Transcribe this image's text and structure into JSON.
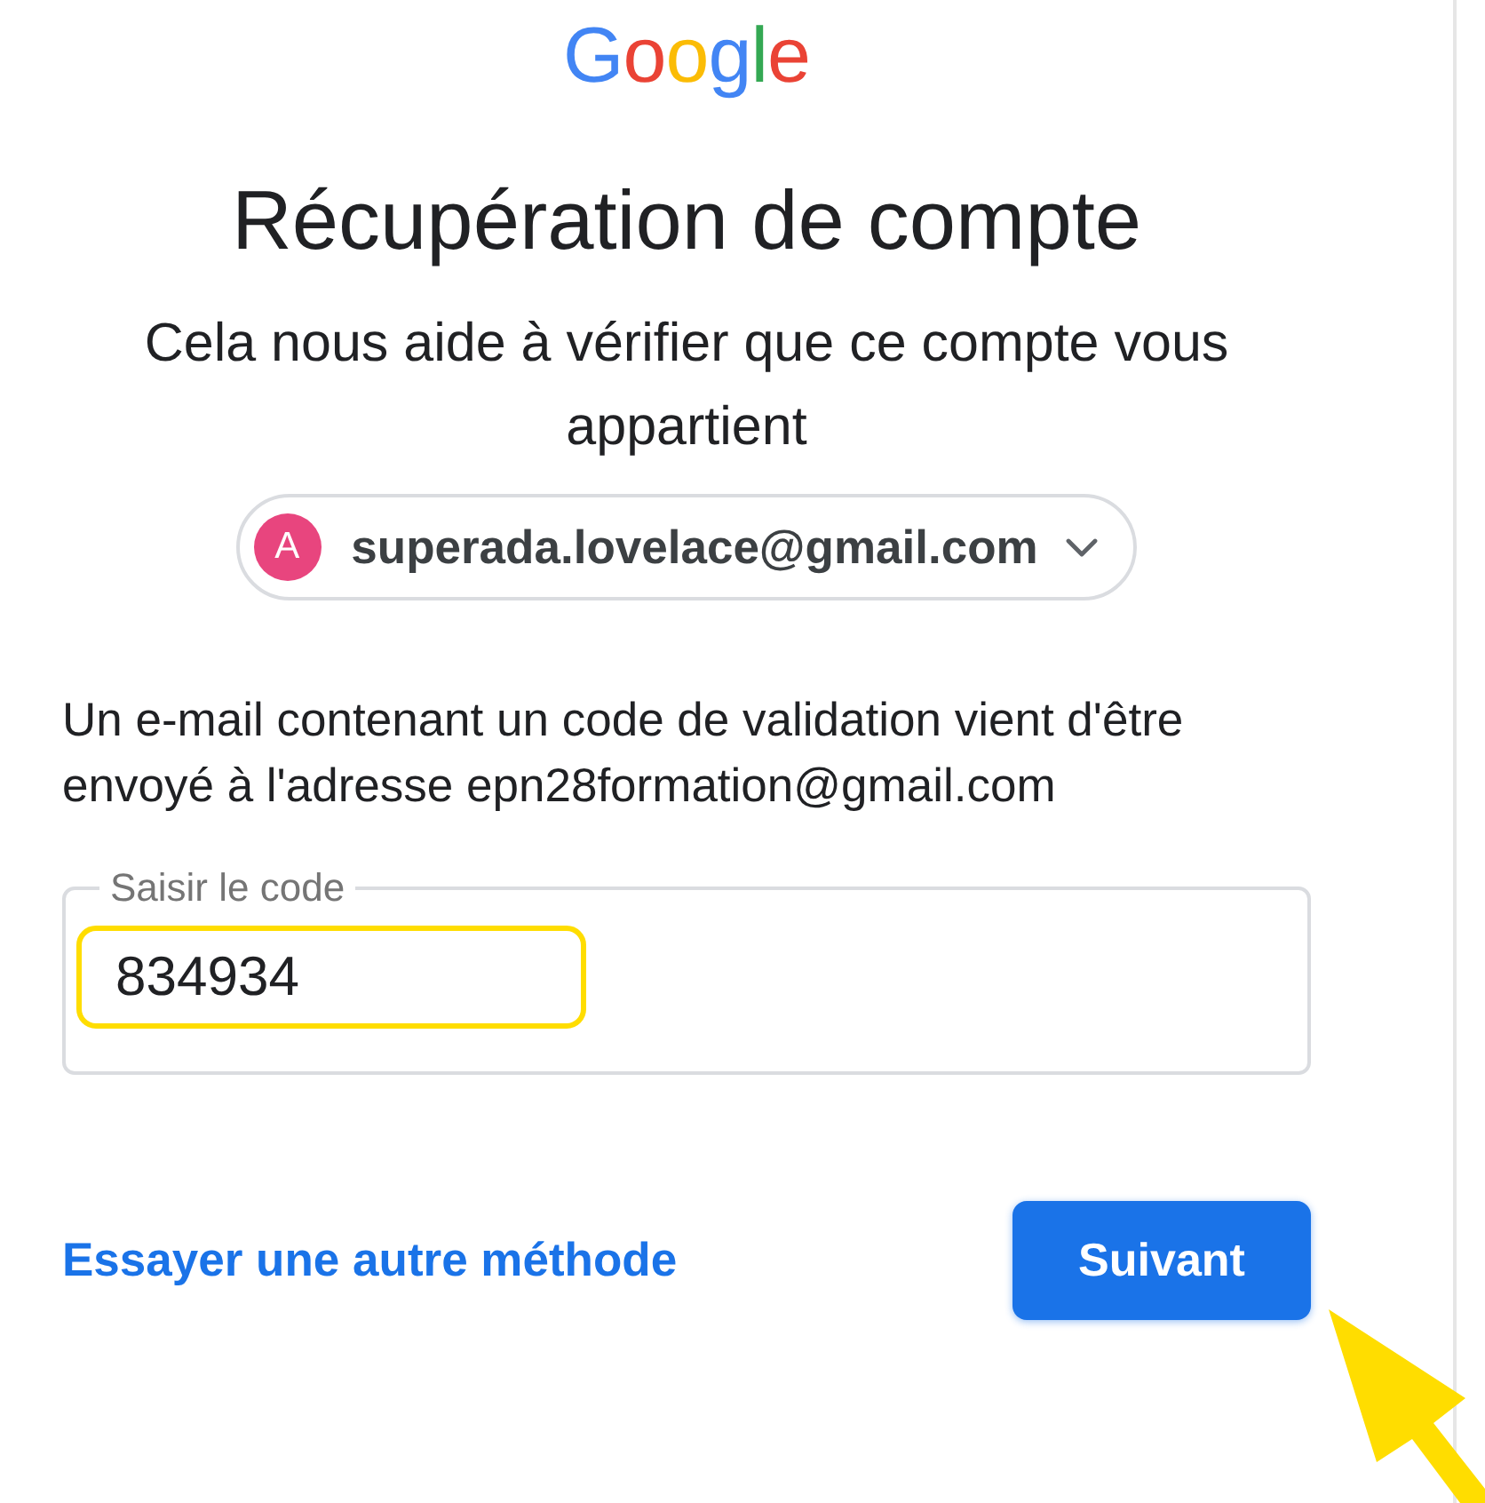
{
  "logo": {
    "text": "Google"
  },
  "heading": {
    "title": "Récupération de compte",
    "subtitle": "Cela nous aide à vérifier que ce compte vous appartient"
  },
  "account": {
    "avatar_letter": "A",
    "email": "superada.lovelace@gmail.com"
  },
  "message": "Un e-mail contenant un code de validation vient d'être envoyé à l'adresse epn28formation@gmail.com",
  "code_field": {
    "label": "Saisir le code",
    "value": "834934"
  },
  "actions": {
    "link": "Essayer une autre méthode",
    "button": "Suivant"
  }
}
